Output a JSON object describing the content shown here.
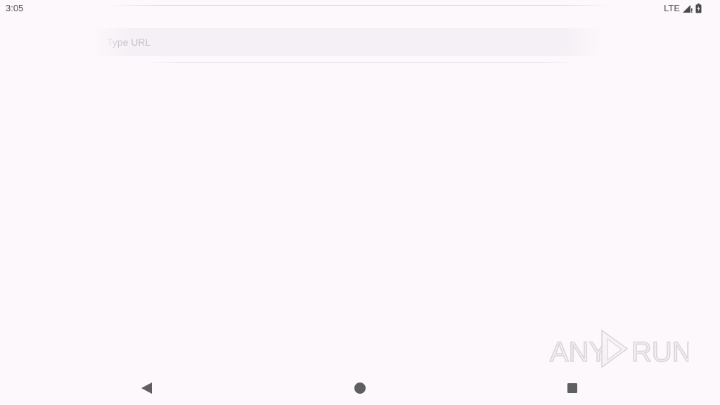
{
  "status_bar": {
    "time": "3:05",
    "network": "LTE",
    "signal_icon": "cell-signal-icon",
    "battery_icon": "battery-charging-icon"
  },
  "browser": {
    "url_placeholder": "Type URL"
  },
  "watermark": {
    "text_left": "ANY",
    "text_right": "RUN"
  },
  "nav_bar": {
    "back_icon": "back-triangle-icon",
    "home_icon": "home-circle-icon",
    "recents_icon": "recents-square-icon"
  },
  "colors": {
    "background": "#fdf8fc",
    "nav_icon": "#5f5f5f",
    "status_text": "#4a4a4a"
  }
}
